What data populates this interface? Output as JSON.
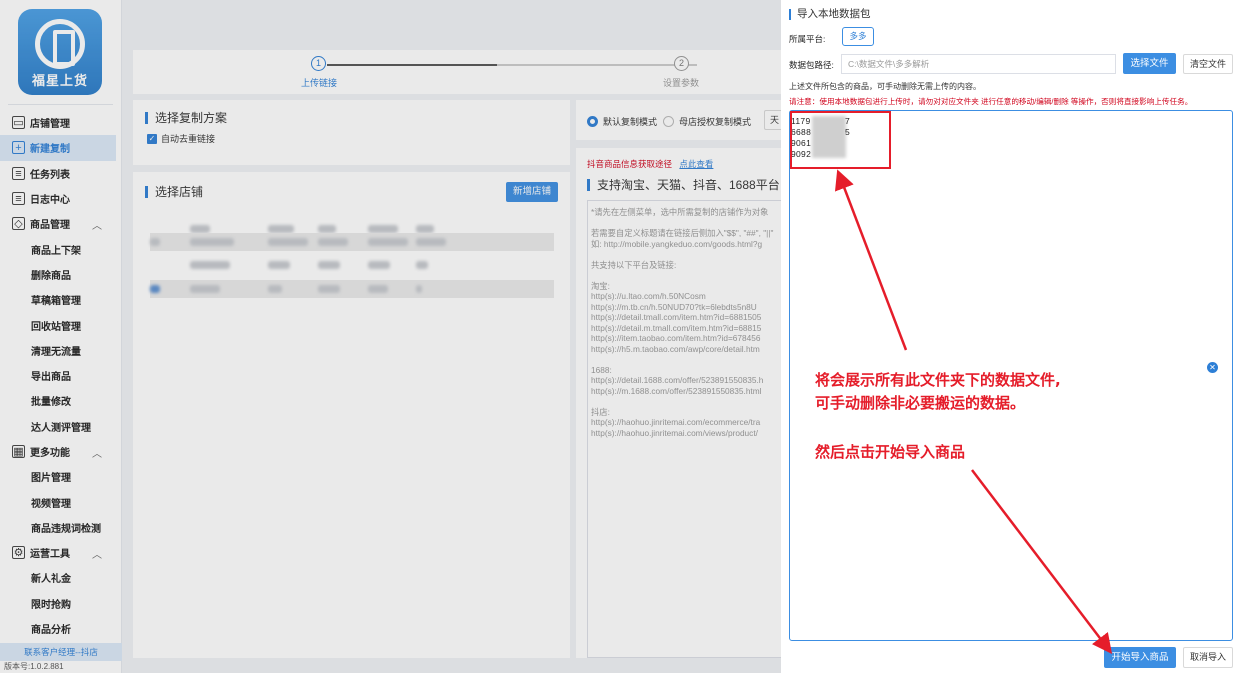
{
  "logo": {
    "text": "福星上货"
  },
  "sidebar": {
    "items": [
      {
        "label": "店铺管理",
        "icon": "shop-icon",
        "glyph": "▭"
      },
      {
        "label": "新建复制",
        "icon": "copy-icon",
        "glyph": "+",
        "active": true
      },
      {
        "label": "任务列表",
        "icon": "task-icon",
        "glyph": "≡"
      },
      {
        "label": "日志中心",
        "icon": "log-icon",
        "glyph": "≡"
      },
      {
        "label": "商品管理",
        "icon": "box-icon",
        "glyph": "◇",
        "expandable": true
      },
      {
        "label": "商品上下架",
        "sub": true
      },
      {
        "label": "删除商品",
        "sub": true
      },
      {
        "label": "草稿箱管理",
        "sub": true
      },
      {
        "label": "回收站管理",
        "sub": true
      },
      {
        "label": "清理无流量",
        "sub": true
      },
      {
        "label": "导出商品",
        "sub": true
      },
      {
        "label": "批量修改",
        "sub": true
      },
      {
        "label": "达人测评管理",
        "sub": true
      },
      {
        "label": "更多功能",
        "icon": "grid-icon",
        "glyph": "▦",
        "expandable": true
      },
      {
        "label": "图片管理",
        "sub": true
      },
      {
        "label": "视频管理",
        "sub": true
      },
      {
        "label": "商品违规词检测",
        "sub": true
      },
      {
        "label": "运营工具",
        "icon": "tools-icon",
        "glyph": "⚙",
        "expandable": true
      },
      {
        "label": "新人礼金",
        "sub": true
      },
      {
        "label": "限时抢购",
        "sub": true
      },
      {
        "label": "商品分析",
        "sub": true
      }
    ],
    "expand_glyph": "︿",
    "contact": "联系客户经理--抖店",
    "version": "版本号:1.0.2.881"
  },
  "steps": {
    "items": [
      {
        "num": "1",
        "label": "上传链接",
        "current": true
      },
      {
        "num": "2",
        "label": "设置参数",
        "current": false
      }
    ]
  },
  "copy_plan": {
    "title": "选择复制方案",
    "check_glyph": "✓",
    "dedupe": "自动去重链接"
  },
  "shop_card": {
    "title": "选择店铺",
    "add_button": "新增店铺"
  },
  "mode": {
    "default": "默认复制模式",
    "mother": "母店授权复制模式",
    "more": "天"
  },
  "link_card": {
    "douyin_hint": "抖音商品信息获取途径",
    "click_view": "点此查看",
    "support_title": "支持淘宝、天猫、抖音、1688平台",
    "instructions": "*请先在左侧菜单，选中所需复制的店铺作为对象\n\n若需要自定义标题请在链接后侧加入\"$$\", \"##\", \"||\"\n如: http://mobile.yangkeduo.com/goods.html?g\n\n共支持以下平台及链接:\n\n淘宝:\nhttp(s)://u.ltao.com/h.50NCosm\nhttp(s)://m.tb.cn/h.50NUD70?tk=6lebdts5n8U\nhttp(s)://detail.tmall.com/item.htm?id=6881505\nhttp(s)://detail.m.tmall.com/item.htm?id=68815\nhttp(s)://item.taobao.com/item.htm?id=678456\nhttp(s)://h5.m.taobao.com/awp/core/detail.htm\n\n1688:\nhttp(s)://detail.1688.com/offer/523891550835.h\nhttp(s)://m.1688.com/offer/523891550835.html\n\n抖店:\nhttp(s)://haohuo.jinritemai.com/ecommerce/tra\nhttp(s)://haohuo.jinritemai.com/views/product/"
  },
  "dialog": {
    "title": "导入本地数据包",
    "platform_label": "所属平台:",
    "platform_value": "多多",
    "path_label": "数据包路径:",
    "path_value": "C:\\数据文件\\多多解析",
    "choose_file": "选择文件",
    "clear_file": "清空文件",
    "desc": "上述文件所包含的商品，可手动删除无需上传的内容。",
    "warning": "请注意：使用本地数据包进行上传时，请勿对对应文件夹 进行任意的移动/编辑/删除 等操作，否则将直接影响上传任务。",
    "files": [
      "1179",
      "6688",
      "9061",
      "9092"
    ],
    "file_tails": [
      "7",
      "5"
    ],
    "clear_glyph": "✕",
    "start_import": "开始导入商品",
    "cancel_import": "取消导入"
  },
  "annotations": {
    "line1": "将会展示所有此文件夹下的数据文件,",
    "line2": "可手动删除非必要搬运的数据。",
    "line3": "然后点击开始导入商品"
  },
  "colors": {
    "accent": "#2d7fd6",
    "annotation": "#e51d2a",
    "warning": "#d0021b"
  }
}
